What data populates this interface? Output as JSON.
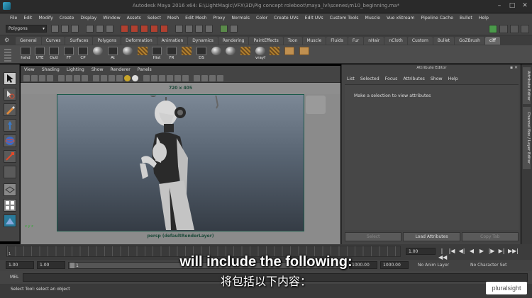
{
  "window": {
    "title": "Autodesk Maya 2016 x64: E:\\LightMagic\\VFX\\3D\\Pig concept roleboot\\maya_lvl\\scenes\\m10_beginning.ma*"
  },
  "menubar": [
    "File",
    "Edit",
    "Modify",
    "Create",
    "Display",
    "Window",
    "Assets",
    "Select",
    "Mesh",
    "Edit Mesh",
    "Proxy",
    "Normals",
    "Color",
    "Create UVs",
    "Edit UVs",
    "Custom Tools",
    "Muscle",
    "Vue xStream",
    "Pipeline Cache",
    "Bullet",
    "Help"
  ],
  "statusline": {
    "mode": "Polygons"
  },
  "shelf_tabs": [
    "General",
    "Curves",
    "Surfaces",
    "Polygons",
    "Deformation",
    "Animation",
    "Dynamics",
    "Rendering",
    "PaintEffects",
    "Toon",
    "Muscle",
    "Fluids",
    "Fur",
    "nHair",
    "nCloth",
    "Custom",
    "Bullet",
    "GoZBrush",
    "ciff"
  ],
  "active_shelf_tab": "ciff",
  "shelf_items": [
    "hshd",
    "UTE",
    "Outl",
    "FT",
    "CP",
    "",
    "At",
    "",
    "",
    "Hist",
    "FR",
    "",
    "DS",
    "",
    "",
    "",
    "vrayf",
    "",
    "",
    ""
  ],
  "viewport": {
    "menu": [
      "View",
      "Shading",
      "Lighting",
      "Show",
      "Renderer",
      "Panels"
    ],
    "resolution": "720 x 405",
    "camera": "persp (defaultRenderLayer)",
    "axis": "x y z"
  },
  "attribute_editor": {
    "title": "Attribute Editor",
    "menu": [
      "List",
      "Selected",
      "Focus",
      "Attributes",
      "Show",
      "Help"
    ],
    "message": "Make a selection to view attributes",
    "buttons": [
      "Select",
      "Load Attributes",
      "Copy Tab"
    ]
  },
  "side_tabs": [
    "Attribute Editor",
    "Channel Box / Layer Editor"
  ],
  "timeline": {
    "ticks": [
      "1",
      "",
      "",
      "",
      "",
      "",
      "",
      "",
      "",
      "",
      "",
      "",
      "",
      "",
      "",
      "",
      "",
      "",
      "",
      "",
      "",
      "",
      "",
      "",
      ""
    ],
    "current_frame": "1.00"
  },
  "range": {
    "start": "1.00",
    "start2": "1.00",
    "handle": "1",
    "end": "1000.00",
    "end2": "1000.00",
    "anim_layer": "No Anim Layer",
    "character_set": "No Character Set"
  },
  "command": {
    "label": "MEL"
  },
  "help_line": "Select Tool: select an object",
  "subtitle": {
    "en": "will include the following:",
    "zh": "将包括以下内容："
  },
  "brand": "pluralsight"
}
